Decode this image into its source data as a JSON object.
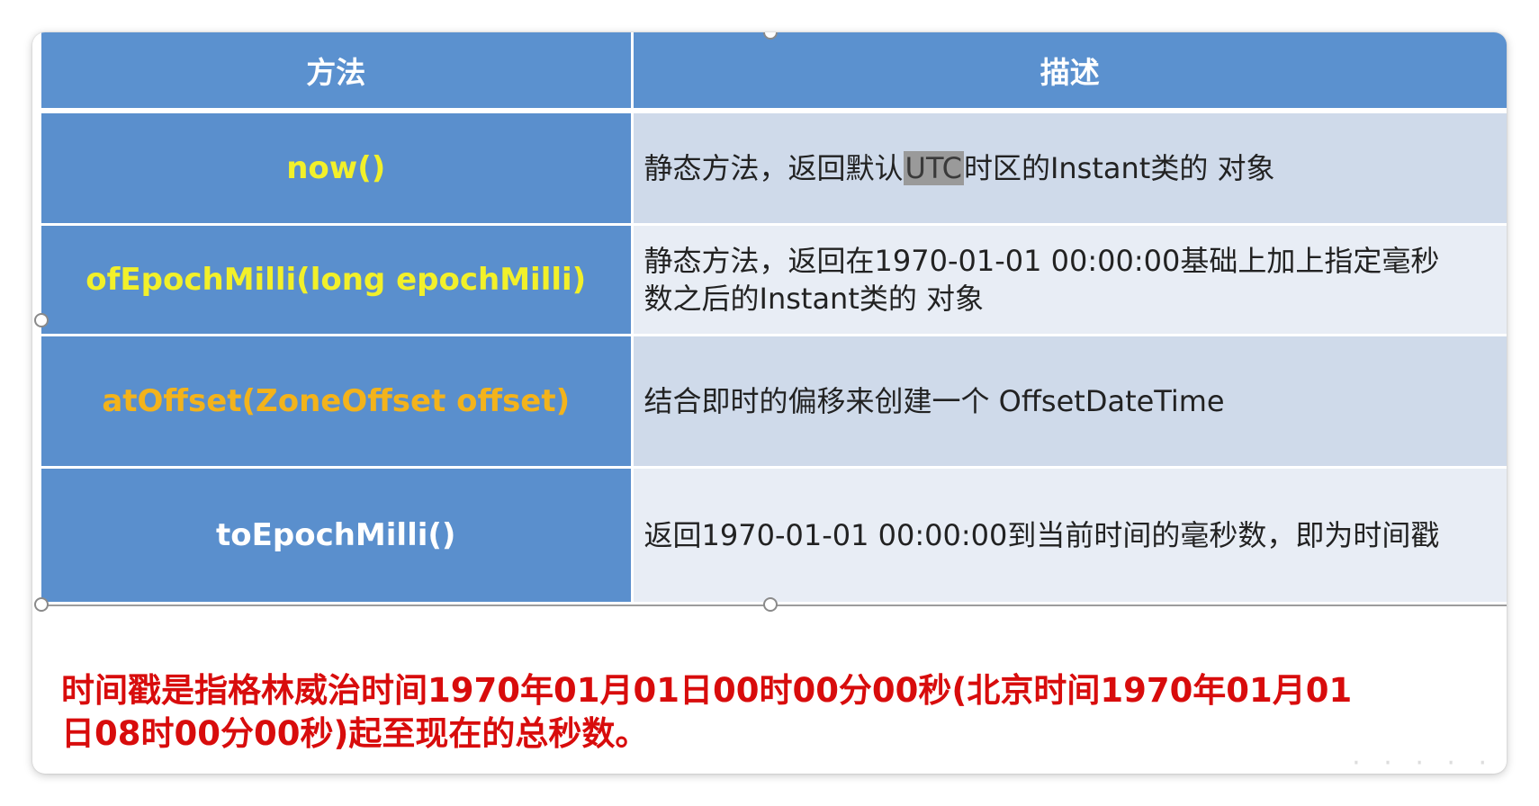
{
  "table": {
    "headers": [
      "方法",
      "描述"
    ],
    "rows": [
      {
        "method": "now()",
        "method_color": "#f2f02a",
        "description_parts": [
          "静态方法，返回默认",
          "UTC",
          "时区的Instant类的 对象"
        ]
      },
      {
        "method": "ofEpochMilli(long epochMilli)",
        "method_color": "#f2f02a",
        "description_lines": [
          "静态方法，返回在1970-01-01 00:00:00基础上加上指定毫秒",
          "数之后的Instant类的 对象"
        ]
      },
      {
        "method": "atOffset(ZoneOffset offset)",
        "method_color": "#f3b31b",
        "description": "结合即时的偏移来创建一个 OffsetDateTime"
      },
      {
        "method": "toEpochMilli()",
        "method_color": "#ffffff",
        "description": "返回1970-01-01 00:00:00到当前时间的毫秒数，即为时间戳"
      }
    ]
  },
  "note": {
    "lines": [
      "时间戳是指格林威治时间1970年01月01日00时00分00秒(北京时间1970年01月01",
      "日08时00分00秒)起至现在的总秒数。"
    ],
    "color": "#d80c0c"
  },
  "colors": {
    "header_bg": "#5b91cf",
    "method_bg": "#5a8fcd",
    "desc_odd_bg": "#cfdaea",
    "desc_even_bg": "#e8edf5",
    "highlight_bg": "#9a9a9a"
  }
}
